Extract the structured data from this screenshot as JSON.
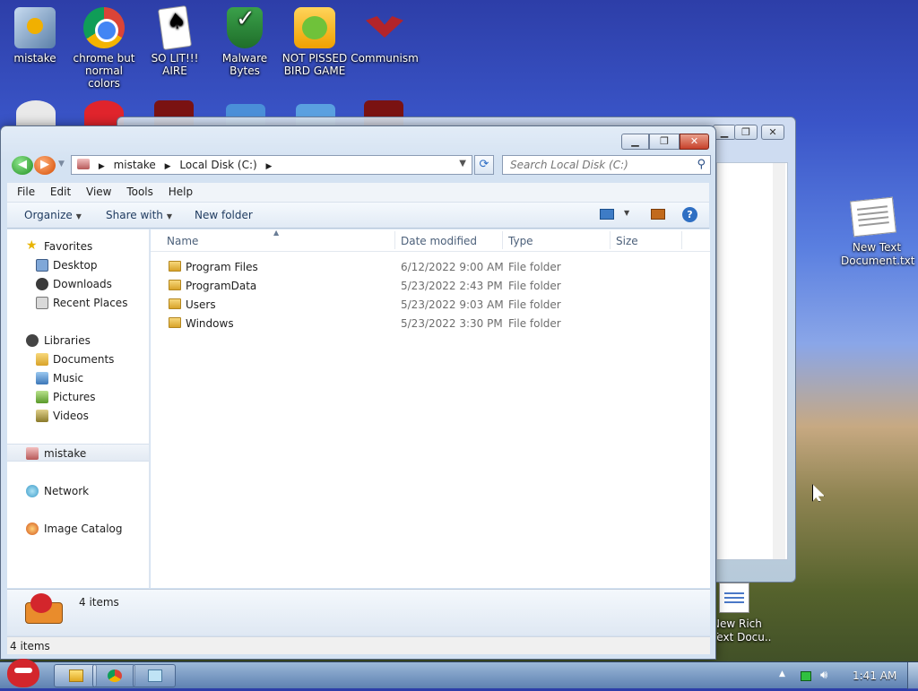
{
  "desktop": {
    "icons": [
      {
        "label": "mistake"
      },
      {
        "label": "chrome but normal colors"
      },
      {
        "label": "SO LIT!!! AIRE"
      },
      {
        "label": "Malware Bytes"
      },
      {
        "label": "NOT PISSED BIRD GAME"
      },
      {
        "label": "Communism"
      }
    ],
    "right_icons": [
      {
        "label_line1": "New Text",
        "label_line2": "Document.txt"
      },
      {
        "label_line1": "New Rich",
        "label_line2": "Text Docu..."
      }
    ]
  },
  "explorer": {
    "address": {
      "crumbs": [
        "mistake",
        "Local Disk (C:)"
      ]
    },
    "search": {
      "placeholder": "Search Local Disk (C:)"
    },
    "menu": [
      "File",
      "Edit",
      "View",
      "Tools",
      "Help"
    ],
    "toolbar": {
      "organize": "Organize",
      "share_with": "Share with",
      "new_folder": "New folder"
    },
    "nav": {
      "favorites": "Favorites",
      "desktop": "Desktop",
      "downloads": "Downloads",
      "recent_places": "Recent Places",
      "libraries": "Libraries",
      "documents": "Documents",
      "music": "Music",
      "pictures": "Pictures",
      "videos": "Videos",
      "computer": "mistake",
      "network": "Network",
      "image_catalog": "Image Catalog"
    },
    "columns": {
      "name": "Name",
      "date_modified": "Date modified",
      "type": "Type",
      "size": "Size"
    },
    "rows": [
      {
        "name": "Program Files",
        "date": "6/12/2022 9:00 AM",
        "type": "File folder"
      },
      {
        "name": "ProgramData",
        "date": "5/23/2022 2:43 PM",
        "type": "File folder"
      },
      {
        "name": "Users",
        "date": "5/23/2022 9:03 AM",
        "type": "File folder"
      },
      {
        "name": "Windows",
        "date": "5/23/2022 3:30 PM",
        "type": "File folder"
      }
    ],
    "details": {
      "count": "4 items"
    },
    "status": {
      "count": "4 items"
    }
  },
  "taskbar": {
    "clock": "1:41 AM"
  }
}
